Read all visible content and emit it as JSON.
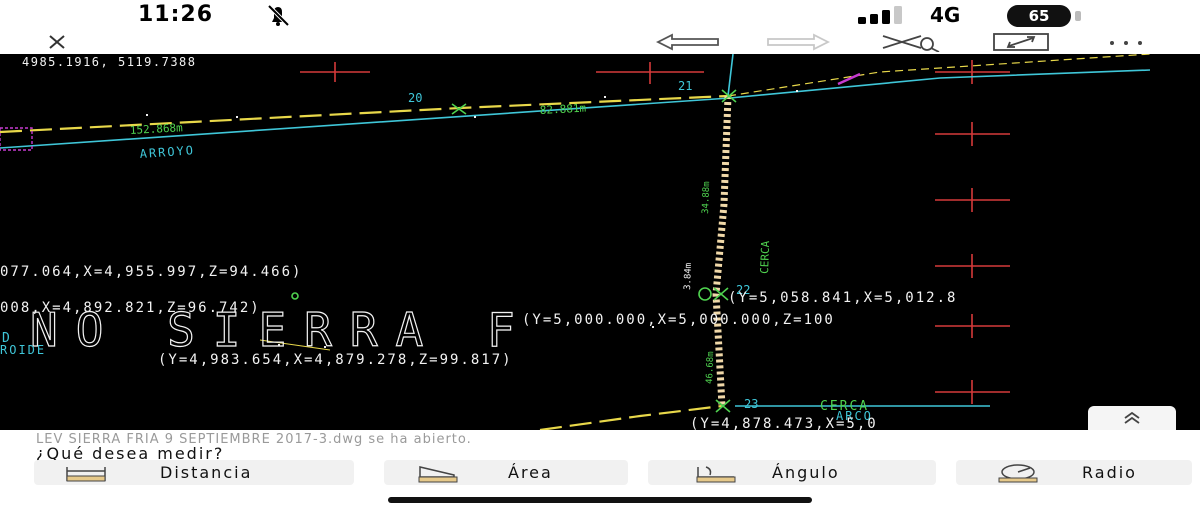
{
  "status_bar": {
    "time": "11:26",
    "network": "4G",
    "battery": "65"
  },
  "toolbar": {
    "close_icon": "close-icon",
    "undo_icon": "undo-arrow-icon",
    "redo_icon": "redo-arrow-icon",
    "measure_icon": "measure-tool-icon",
    "fullscreen_icon": "fullscreen-icon",
    "more_icon": "more-icon"
  },
  "cad": {
    "coord_readout": "4985.1916, 5119.7388",
    "points": [
      "20",
      "21",
      "22",
      "23"
    ],
    "segments": [
      "152.868m",
      "82.881m",
      "34.88m",
      "3.84m",
      "46.68m"
    ],
    "labels": {
      "arroyo": "ARROYO",
      "cerca": "CERCA",
      "cerca_vertical": "CERCA",
      "arco": "ARCO",
      "roide": "ROIDE",
      "d_fragment": "D",
      "large_title": "NO SIERRA F"
    },
    "coordinates": [
      "077.064,X=4,955.997,Z=94.466)",
      "008,X=4,892.821,Z=96.742)",
      "(Y=5,058.841,X=5,012.8",
      "(Y=5,000.000,X=5,000.000,Z=100",
      "(Y=4,983.654,X=4,879.278,Z=99.817)",
      "(Y=4,878.473,X=5,0"
    ],
    "colors": {
      "background": "#000000",
      "cyan": "#3fc6d8",
      "yellow": "#e8d84a",
      "green": "#4fd24f",
      "red": "#d63a3a",
      "magenta": "#c63ad0",
      "white": "#f2f2f2"
    }
  },
  "message": {
    "opened": "LEV SIERRA FRIA 9 SEPTIEMBRE 2017-3.dwg se ha abierto.",
    "question": "¿Qué desea medir?"
  },
  "measure_buttons": [
    {
      "label": "Distancia",
      "icon": "distance-ruler-icon"
    },
    {
      "label": "Área",
      "icon": "area-icon"
    },
    {
      "label": "Ángulo",
      "icon": "angle-icon"
    },
    {
      "label": "Radio",
      "icon": "radius-icon"
    }
  ]
}
